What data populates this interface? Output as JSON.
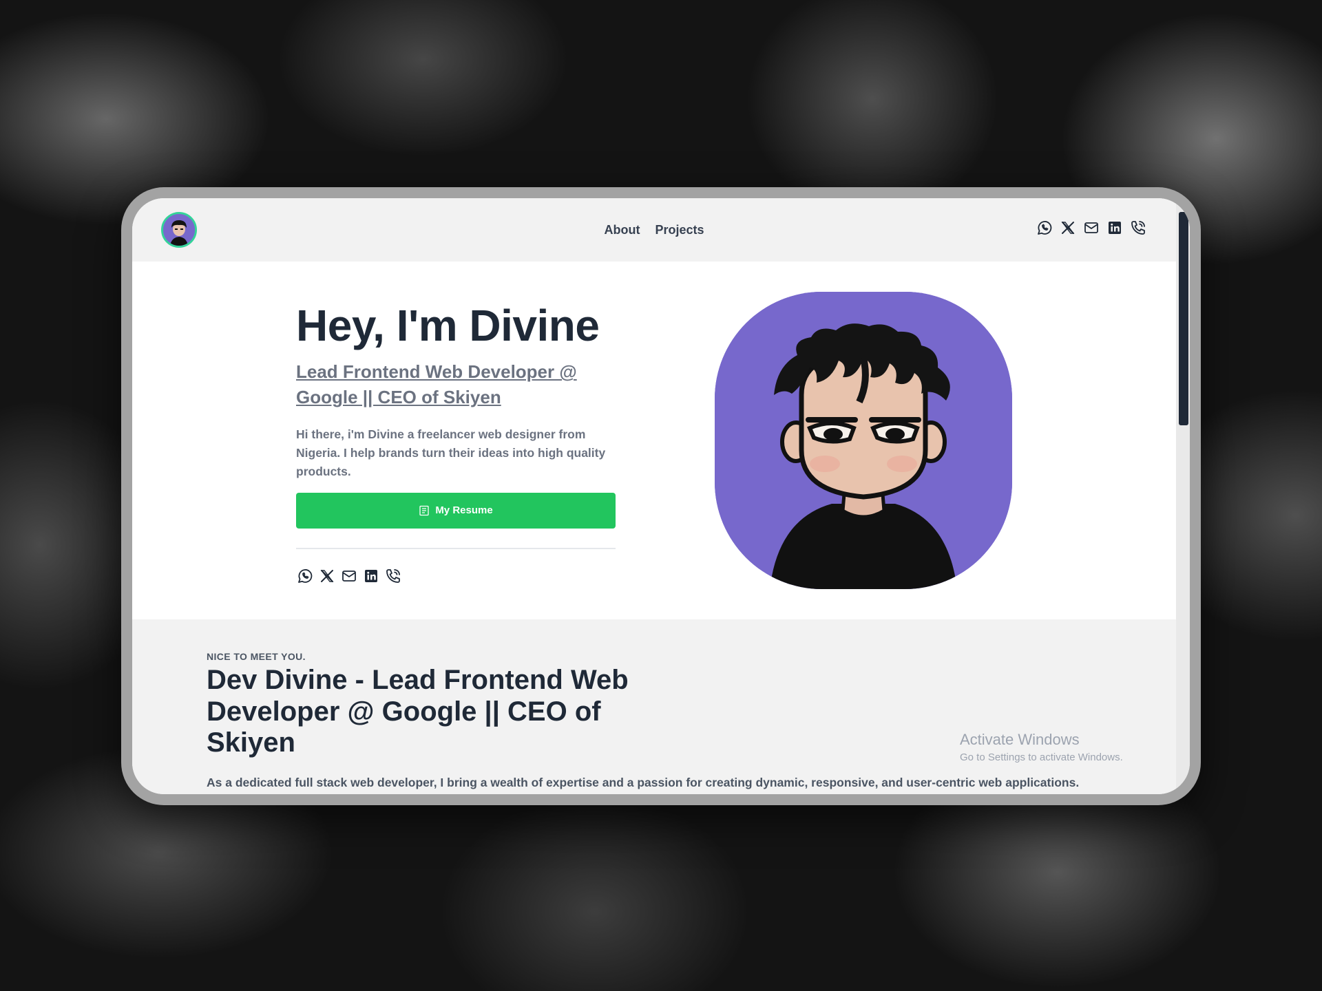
{
  "nav": {
    "links": [
      "About",
      "Projects"
    ]
  },
  "social_icons": [
    "whatsapp-icon",
    "x-icon",
    "mail-icon",
    "linkedin-icon",
    "phone-icon"
  ],
  "hero": {
    "title": "Hey, I'm Divine",
    "subtitle": "Lead Frontend Web Developer @ Google || CEO of Skiyen",
    "description": "Hi there, i'm Divine a freelancer web designer from Nigeria. I help brands turn their ideas into high quality products.",
    "resume_label": "My Resume"
  },
  "about": {
    "kicker": "NICE TO MEET YOU.",
    "title": "Dev Divine - Lead Frontend Web Developer @ Google || CEO of Skiyen",
    "body": "As a dedicated full stack web developer, I bring a wealth of expertise and a passion for creating dynamic, responsive, and user-centric web applications. With a solid foundation in both front-end and back-end technologies, I excel at transforming complex requirements into seamless digital"
  },
  "watermark": {
    "line1": "Activate Windows",
    "line2": "Go to Settings to activate Windows."
  },
  "colors": {
    "accent_green": "#22c55e",
    "avatar_purple": "#7768cc",
    "text_dark": "#1f2937"
  }
}
